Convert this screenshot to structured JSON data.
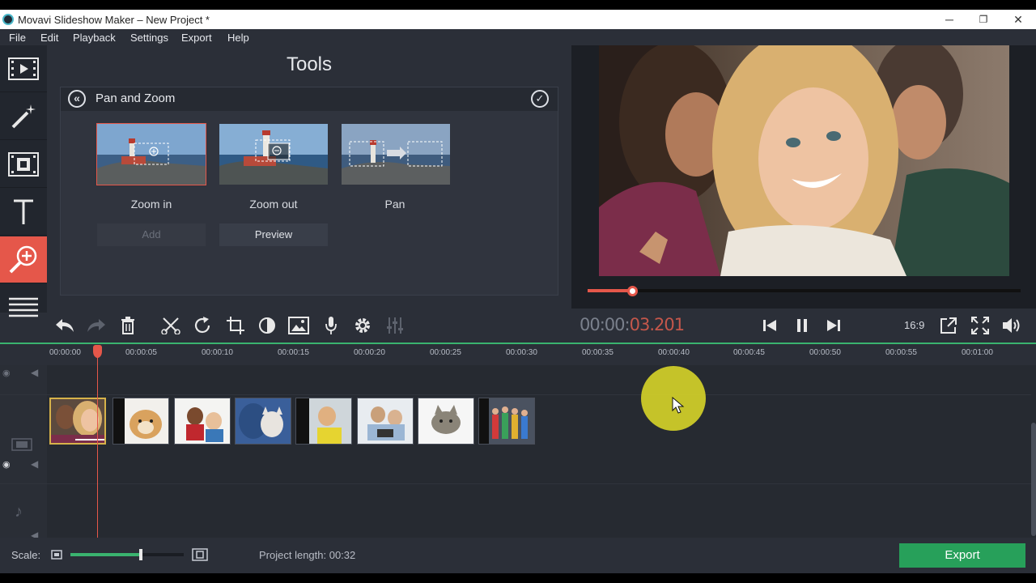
{
  "window": {
    "title": "Movavi Slideshow Maker – New Project *",
    "minimize": "─",
    "restore": "❐",
    "close": "✕"
  },
  "menu": [
    "File",
    "Edit",
    "Playback",
    "Settings",
    "Export",
    "Help"
  ],
  "sidebar": {
    "tools": [
      {
        "name": "filmstrip-icon",
        "active": false
      },
      {
        "name": "magic-wand-icon",
        "active": false
      },
      {
        "name": "transition-icon",
        "active": false
      },
      {
        "name": "title-icon",
        "active": false
      },
      {
        "name": "zoom-icon",
        "active": true
      },
      {
        "name": "more-icon",
        "active": false
      }
    ]
  },
  "tools_panel": {
    "title": "Tools",
    "section": "Pan and Zoom",
    "effects": [
      {
        "label": "Zoom in",
        "selected": true
      },
      {
        "label": "Zoom out",
        "selected": false
      },
      {
        "label": "Pan",
        "selected": false
      }
    ],
    "add_label": "Add",
    "preview_label": "Preview"
  },
  "player": {
    "time_dim": "00:00:",
    "time_active": "03.201",
    "aspect_ratio": "16:9",
    "progress": 0.105
  },
  "timeline": {
    "ticks": [
      "00:00:00",
      "00:00:05",
      "00:00:10",
      "00:00:15",
      "00:00:20",
      "00:00:25",
      "00:00:30",
      "00:00:35",
      "00:00:40",
      "00:00:45",
      "00:00:50",
      "00:00:55",
      "00:01:00"
    ],
    "clips": [
      "selfie-group",
      "dog",
      "kids",
      "cat-blue",
      "kid-yellow",
      "family-laptop",
      "kitten",
      "kids-crowd"
    ]
  },
  "bottom": {
    "scale_label": "Scale:",
    "project_length": "Project length: 00:32",
    "scale_value": 0.62,
    "export_label": "Export"
  },
  "colors": {
    "accent": "#e5574a",
    "export": "#27a05a",
    "timeline_green": "#3ab36f"
  }
}
